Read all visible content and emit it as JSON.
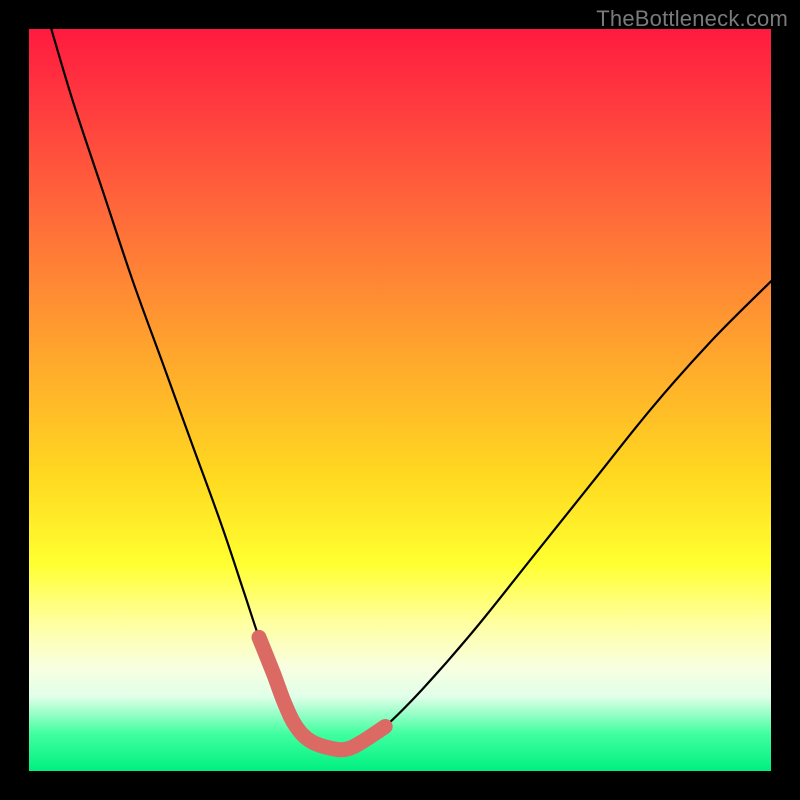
{
  "watermark": "TheBottleneck.com",
  "chart_data": {
    "type": "line",
    "title": "",
    "xlabel": "",
    "ylabel": "",
    "xlim": [
      0,
      100
    ],
    "ylim": [
      0,
      100
    ],
    "grid": false,
    "legend": false,
    "series": [
      {
        "name": "black-curve",
        "color": "#000000",
        "x": [
          3,
          6,
          10,
          14,
          18,
          22,
          26,
          29,
          31,
          33,
          34.5,
          36,
          38,
          41,
          43,
          45,
          48,
          53,
          60,
          68,
          76,
          84,
          92,
          100
        ],
        "values": [
          100,
          90,
          78,
          66,
          55,
          44,
          33,
          24,
          18,
          13,
          9,
          6,
          4,
          3,
          3,
          4,
          6,
          11,
          19,
          29,
          39,
          49,
          58,
          66
        ]
      },
      {
        "name": "red-marker-segment",
        "color": "#da6a63",
        "x": [
          31,
          33,
          34.5,
          36,
          38,
          41,
          43,
          45,
          48
        ],
        "values": [
          18,
          13,
          9,
          6,
          4,
          3,
          3,
          4,
          6
        ]
      }
    ],
    "annotations": []
  }
}
